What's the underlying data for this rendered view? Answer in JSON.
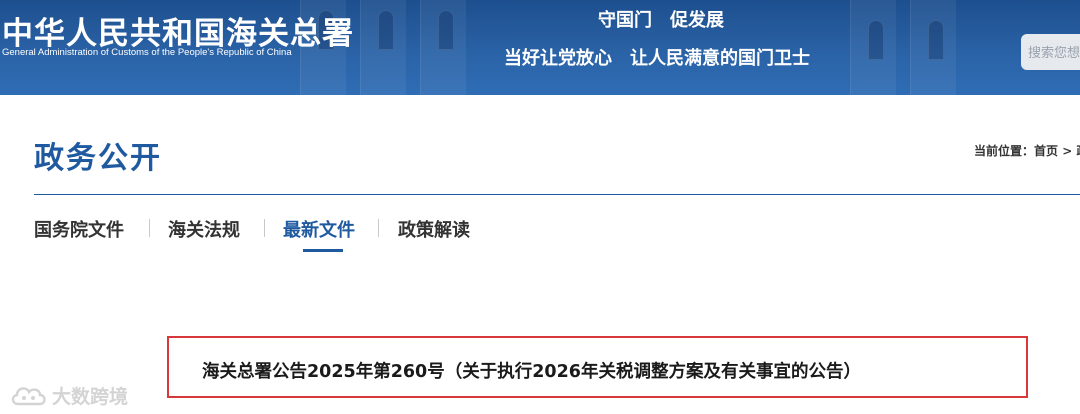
{
  "header": {
    "logo_title": "中华人民共和国海关总署",
    "logo_subtitle": "General Administration of Customs of the People's Republic of China",
    "slogan_line1": "守国门　促发展",
    "slogan_line2": "当好让党放心　让人民满意的国门卫士",
    "search_placeholder": "搜索您想",
    "colors": {
      "banner": "#2a62a6",
      "text": "#ffffff"
    }
  },
  "section": {
    "title": "政务公开",
    "breadcrumb_label": "当前位置：",
    "breadcrumb_home": "首页",
    "breadcrumb_sep": " > ",
    "breadcrumb_next": "政"
  },
  "tabs": [
    {
      "label": "国务院文件",
      "active": false
    },
    {
      "label": "海关法规",
      "active": false
    },
    {
      "label": "最新文件",
      "active": true
    },
    {
      "label": "政策解读",
      "active": false
    }
  ],
  "notice": {
    "title": "海关总署公告2025年第260号（关于执行2026年关税调整方案及有关事宜的公告）",
    "highlight_color": "#d9383a"
  },
  "watermark": {
    "text": "大数跨境",
    "icon": "cloud-logo-icon"
  },
  "colors": {
    "accent": "#1f5aa0",
    "tab_text": "#333333"
  }
}
